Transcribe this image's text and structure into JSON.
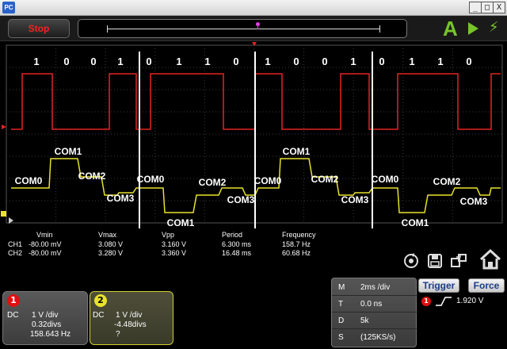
{
  "titlebar": {
    "logo": "PC",
    "minimize": "_",
    "restore": "□",
    "close": "X"
  },
  "toolbar": {
    "stop_label": "Stop",
    "auto_label": "A",
    "run_icon": "play-icon",
    "single_icon": "lightning-icon"
  },
  "colors": {
    "ch1": "#e52222",
    "ch2": "#e8e22a",
    "accent": "#76c52a",
    "stop": "#ff2020"
  },
  "scope": {
    "bits": [
      "1",
      "0",
      "0",
      "1",
      "0",
      "1",
      "1",
      "0",
      "1",
      "0",
      "0",
      "1",
      "0",
      "1",
      "1",
      "0"
    ],
    "com_labels": [
      "COM0",
      "COM1",
      "COM2",
      "COM3",
      "COM0",
      "COM1",
      "COM2",
      "COM3",
      "COM0",
      "COM1",
      "COM2",
      "COM3",
      "COM0",
      "COM1",
      "COM2",
      "COM3"
    ],
    "ch1_marker": "1",
    "ch2_marker": "2"
  },
  "measurements": {
    "headers": [
      "Vmin",
      "Vmax",
      "Vpp",
      "Period",
      "Frequency"
    ],
    "rows": [
      {
        "ch": "CH1",
        "vmin": "-80.00 mV",
        "vmax": "3.080 V",
        "vpp": "3.160 V",
        "period": "6.300 ms",
        "freq": "158.7 Hz"
      },
      {
        "ch": "CH2",
        "vmin": "-80.00 mV",
        "vmax": "3.280 V",
        "vpp": "3.360 V",
        "period": "16.48 ms",
        "freq": "60.68 Hz"
      }
    ]
  },
  "channels": [
    {
      "badge": "1",
      "coupling": "DC",
      "scale": "1 V /div",
      "offset": "0.32divs",
      "freq": "158.643 Hz"
    },
    {
      "badge": "2",
      "coupling": "DC",
      "scale": "1 V /div",
      "offset": "-4.48divs",
      "freq": "?"
    }
  ],
  "timebase": [
    {
      "key": "M",
      "value": "2ms /div"
    },
    {
      "key": "T",
      "value": "0.0 ns"
    },
    {
      "key": "D",
      "value": "5k"
    },
    {
      "key": "S",
      "value": "(125KS/s)"
    }
  ],
  "trigger": {
    "trigger_label": "Trigger",
    "force_label": "Force",
    "badge": "1",
    "level": "1.920 V"
  },
  "icons": [
    "rotate-icon",
    "save-icon",
    "export-icon",
    "home-icon"
  ]
}
